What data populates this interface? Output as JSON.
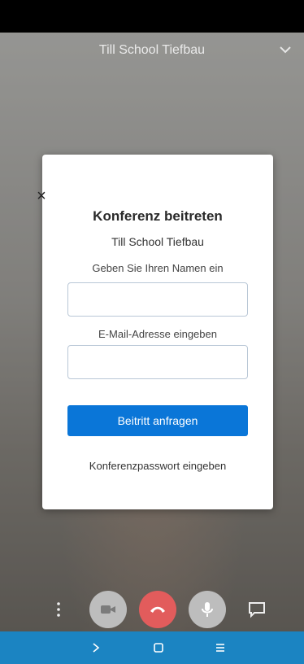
{
  "call": {
    "title": "Till School Tiefbau",
    "header_chevron_icon": "chevron-down-icon"
  },
  "dialog": {
    "close_label": "×",
    "title": "Konferenz beitreten",
    "meeting_name": "Till School Tiefbau",
    "name_label": "Geben Sie Ihren Namen ein",
    "name_value": "",
    "email_label": "E-Mail-Adresse eingeben",
    "email_value": "",
    "join_button": "Beitritt anfragen",
    "password_link": "Konferenzpasswort eingeben"
  },
  "toolbar": {
    "buttons": [
      {
        "icon": "more-vertical-icon"
      },
      {
        "icon": "camera-icon",
        "color": "#bdbdbd"
      },
      {
        "icon": "hangup-icon",
        "color": "#e25c5c"
      },
      {
        "icon": "microphone-icon",
        "color": "#bdbdbd"
      },
      {
        "icon": "chat-icon"
      }
    ]
  },
  "navigation": {
    "back_icon": "chevron-right-icon",
    "home_icon": "square-icon",
    "recents_icon": "menu-lines-icon",
    "bar_color": "#1b84c2"
  },
  "colors": {
    "accent": "#0a76d8",
    "hangup": "#e25c5c"
  }
}
